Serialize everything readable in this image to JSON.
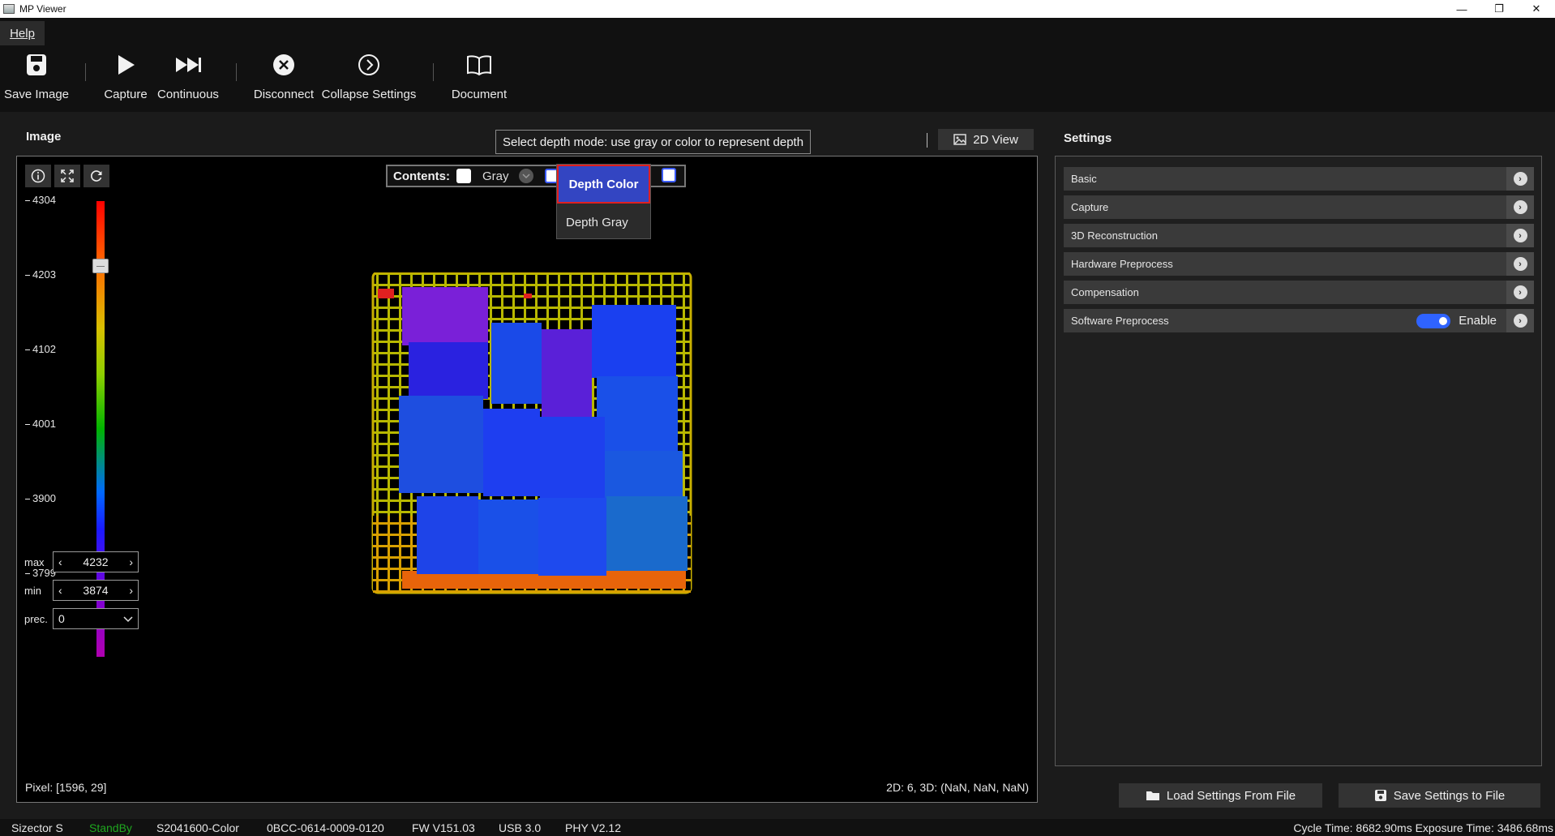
{
  "window": {
    "title": "MP Viewer",
    "controls": {
      "minimize": "—",
      "restore": "❐",
      "close": "✕"
    }
  },
  "menu": {
    "help": "Help"
  },
  "toolbar": {
    "save_image": "Save Image",
    "capture": "Capture",
    "continuous": "Continuous",
    "disconnect": "Disconnect",
    "collapse_settings": "Collapse Settings",
    "document": "Document"
  },
  "image_panel": {
    "title": "Image",
    "tooltip": "Select depth mode: use gray or color to represent depth",
    "view_2d": "2D View",
    "contents": {
      "label": "Contents:",
      "gray": "Gray",
      "dropdown_options": [
        "Depth Color",
        "Depth Gray"
      ],
      "selected": "Depth Color"
    },
    "scale_ticks": [
      "4304",
      "4203",
      "4102",
      "4001",
      "3900",
      "3799"
    ],
    "max": {
      "label": "max",
      "value": "4232"
    },
    "min": {
      "label": "min",
      "value": "3874"
    },
    "precision": {
      "label": "prec.",
      "value": "0"
    },
    "pixel_info": "Pixel: [1596, 29]",
    "coord_info": "2D: 6, 3D: (NaN, NaN, NaN)"
  },
  "settings": {
    "title": "Settings",
    "sections": [
      "Basic",
      "Capture",
      "3D Reconstruction",
      "Hardware Preprocess",
      "Compensation",
      "Software Preprocess"
    ],
    "software_preprocess_toggle": "Enable",
    "load_button": "Load Settings From File",
    "save_button": "Save Settings to File"
  },
  "status": {
    "camera": "Sizector S",
    "state": "StandBy",
    "serial": "S2041600-Color",
    "id": "0BCC-0614-0009-0120",
    "fw": "FW V151.03",
    "usb": "USB 3.0",
    "phy": "PHY V2.12",
    "timing": "Cycle Time: 8682.90ms Exposure Time: 3486.68ms"
  },
  "colors": {
    "accent": "#3345c2",
    "highlight_border": "#e02020",
    "standby": "#1fa81f",
    "toggle": "#2f63ff"
  }
}
